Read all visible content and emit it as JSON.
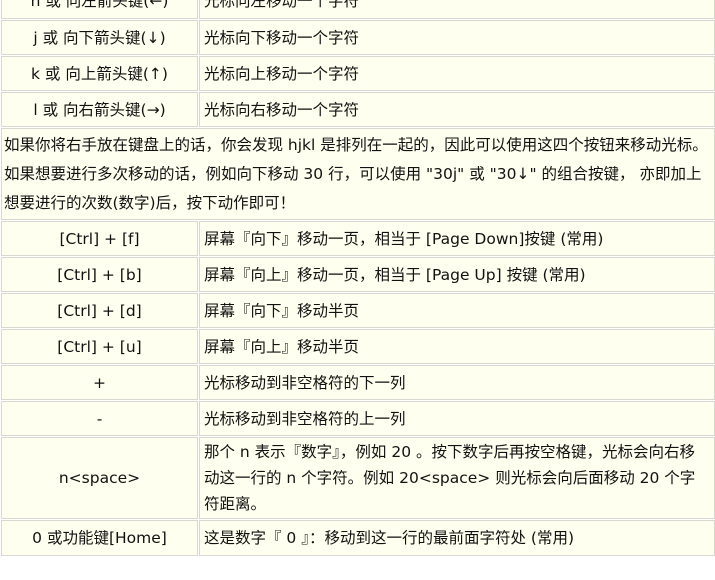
{
  "rows_top": [
    {
      "key": "h 或 向左箭头键(←)",
      "desc": "光标向左移动一个字符"
    },
    {
      "key": "j 或 向下箭头键(↓)",
      "desc": "光标向下移动一个字符"
    },
    {
      "key": "k 或 向上箭头键(↑)",
      "desc": "光标向上移动一个字符"
    },
    {
      "key": "l 或 向右箭头键(→)",
      "desc": "光标向右移动一个字符"
    }
  ],
  "note": "如果你将右手放在键盘上的话，你会发现 hjkl 是排列在一起的，因此可以使用这四个按钮来移动光标。 如果想要进行多次移动的话，例如向下移动 30 行，可以使用 \"30j\" 或 \"30↓\" 的组合按键， 亦即加上想要进行的次数(数字)后，按下动作即可！",
  "rows_bottom": [
    {
      "key": "[Ctrl] + [f]",
      "desc": "屏幕『向下』移动一页，相当于 [Page Down]按键 (常用)"
    },
    {
      "key": "[Ctrl] + [b]",
      "desc": "屏幕『向上』移动一页，相当于 [Page Up] 按键 (常用)"
    },
    {
      "key": "[Ctrl] + [d]",
      "desc": "屏幕『向下』移动半页"
    },
    {
      "key": "[Ctrl] + [u]",
      "desc": "屏幕『向上』移动半页"
    },
    {
      "key": "+",
      "desc": "光标移动到非空格符的下一列"
    },
    {
      "key": "-",
      "desc": "光标移动到非空格符的上一列"
    },
    {
      "key": "n<space>",
      "desc": "那个 n 表示『数字』，例如 20 。按下数字后再按空格键，光标会向右移动这一行的 n 个字符。例如 20<space> 则光标会向后面移动 20 个字符距离。"
    },
    {
      "key": "0 或功能键[Home]",
      "desc": "这是数字『 0 』：移动到这一行的最前面字符处 (常用)"
    }
  ]
}
